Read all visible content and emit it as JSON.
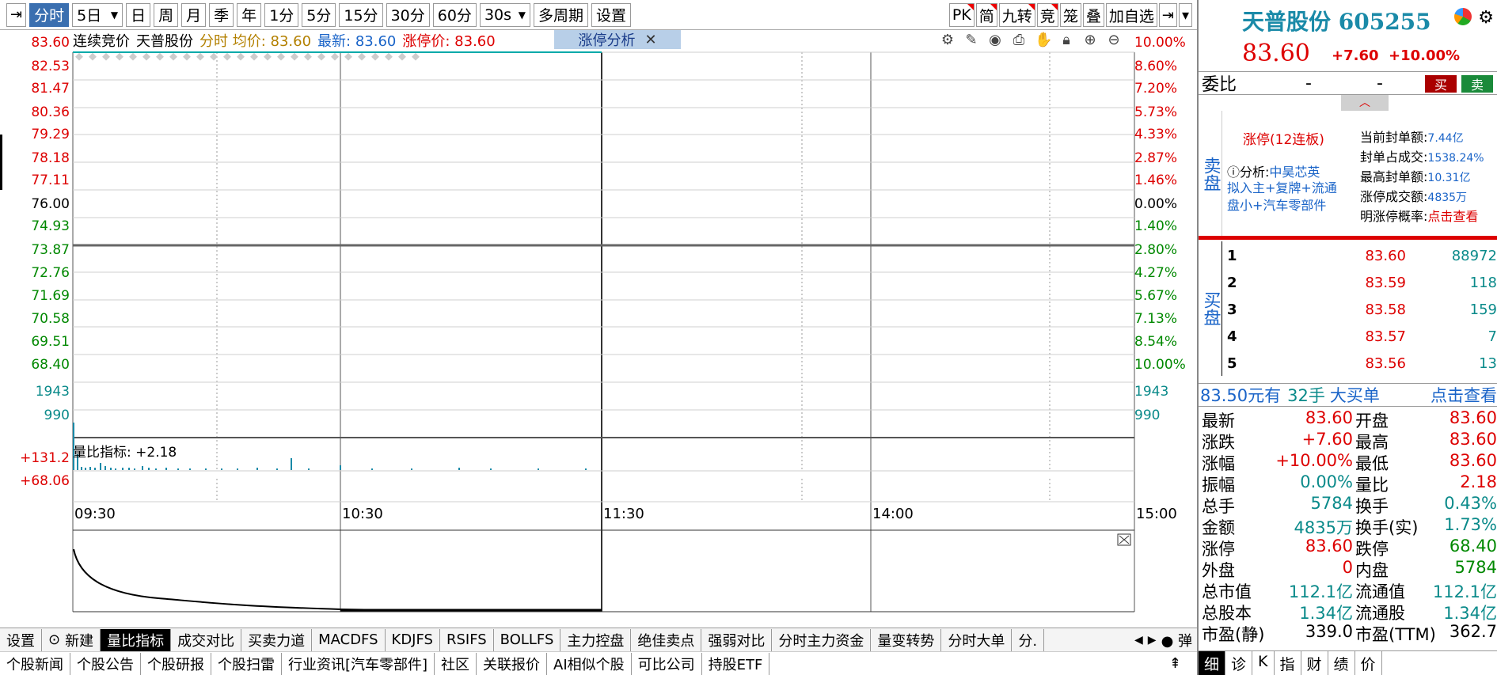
{
  "toolbar": {
    "items": [
      "分时",
      "5日",
      "日",
      "周",
      "月",
      "季",
      "年",
      "1分",
      "5分",
      "15分",
      "30分",
      "60分",
      "30s",
      "多周期",
      "设置"
    ],
    "right_items": [
      "PK",
      "简",
      "九转",
      "竞",
      "笼",
      "叠",
      "加自选"
    ]
  },
  "chart": {
    "info": {
      "auction": "连续竞价",
      "name": "天普股份",
      "avg": "分时 均价: 83.60",
      "latest": "最新: 83.60",
      "limit": "涨停价: 83.60"
    },
    "analysis_box": "涨停分析",
    "y_left": [
      "83.60",
      "82.53",
      "81.47",
      "80.36",
      "79.29",
      "78.18",
      "77.11",
      "76.00",
      "74.93",
      "73.87",
      "72.76",
      "71.69",
      "70.58",
      "69.51",
      "68.40"
    ],
    "y_right": [
      "10.00%",
      "8.60%",
      "7.20%",
      "5.73%",
      "4.33%",
      "2.87%",
      "1.46%",
      "0.00%",
      "1.40%",
      "2.80%",
      "4.27%",
      "5.67%",
      "7.13%",
      "8.54%",
      "10.00%"
    ],
    "vol_left": [
      "1943",
      "990"
    ],
    "vol_right": [
      "1943",
      "990"
    ],
    "ind_left": [
      "+131.2",
      "+68.06"
    ],
    "indicator_label": "量比指标: +2.18",
    "x_labels": [
      "09:30",
      "10:30",
      "11:30",
      "14:00",
      "15:00"
    ]
  },
  "tabs_row1": [
    "设置",
    "新建",
    "量比指标",
    "成交对比",
    "买卖力道",
    "MACDFS",
    "KDJFS",
    "RSIFS",
    "BOLLFS",
    "主力控盘",
    "绝佳卖点",
    "强弱对比",
    "分时主力资金",
    "量变转势",
    "分时大单",
    "分."
  ],
  "tabs_row2": [
    "个股新闻",
    "个股公告",
    "个股研报",
    "个股扫雷",
    "行业资讯[汽车零部件]",
    "社区",
    "关联报价",
    "AI相似个股",
    "可比公司",
    "持股ETF"
  ],
  "toggle_label": "弹",
  "quote": {
    "title": "天普股份 605255",
    "price": "83.60",
    "change": "+7.60",
    "pct": "+10.00%",
    "weibi_label": "委比",
    "weibi_v1": "-",
    "weibi_v2": "-",
    "buy": "买",
    "sell": "卖",
    "sell_label": "卖盘",
    "buy_label": "买盘",
    "zt_title": "涨停(12连板)",
    "analysis_prefix": "分析:",
    "analysis_name": "中昊芯英",
    "analysis_text": "拟入主+复牌+流通盘小+汽车零部件",
    "zt_stats": [
      {
        "k": "当前封单额:",
        "v": "7.44亿"
      },
      {
        "k": "封单占成交:",
        "v": "1538.24%"
      },
      {
        "k": "最高封单额:",
        "v": "10.31亿"
      },
      {
        "k": "涨停成交额:",
        "v": "4835万"
      },
      {
        "k": "明涨停概率:",
        "v": "点击查看"
      }
    ],
    "bids": [
      {
        "n": "1",
        "p": "83.60",
        "q": "88972"
      },
      {
        "n": "2",
        "p": "83.59",
        "q": "118"
      },
      {
        "n": "3",
        "p": "83.58",
        "q": "159"
      },
      {
        "n": "4",
        "p": "83.57",
        "q": "7"
      },
      {
        "n": "5",
        "p": "83.56",
        "q": "13"
      }
    ],
    "big_order": {
      "price": "83.50元有",
      "hands": "32手",
      "label": "大买单",
      "link": "点击查看"
    },
    "stats": [
      {
        "k1": "最新",
        "v1": "83.60",
        "c1": "red",
        "k2": "开盘",
        "v2": "83.60",
        "c2": "red"
      },
      {
        "k1": "涨跌",
        "v1": "+7.60",
        "c1": "red",
        "k2": "最高",
        "v2": "83.60",
        "c2": "red"
      },
      {
        "k1": "涨幅",
        "v1": "+10.00%",
        "c1": "red",
        "k2": "最低",
        "v2": "83.60",
        "c2": "red"
      },
      {
        "k1": "振幅",
        "v1": "0.00%",
        "c1": "teal",
        "k2": "量比",
        "v2": "2.18",
        "c2": "red"
      },
      {
        "k1": "总手",
        "v1": "5784",
        "c1": "teal",
        "k2": "换手",
        "v2": "0.43%",
        "c2": "teal"
      },
      {
        "k1": "金额",
        "v1": "4835万",
        "c1": "teal",
        "k2": "换手(实)",
        "v2": "1.73%",
        "c2": "teal"
      },
      {
        "k1": "涨停",
        "v1": "83.60",
        "c1": "red",
        "k2": "跌停",
        "v2": "68.40",
        "c2": "green"
      },
      {
        "k1": "外盘",
        "v1": "0",
        "c1": "red",
        "k2": "内盘",
        "v2": "5784",
        "c2": "green"
      },
      {
        "k1": "总市值",
        "v1": "112.1亿",
        "c1": "teal",
        "k2": "流通值",
        "v2": "112.1亿",
        "c2": "teal"
      },
      {
        "k1": "总股本",
        "v1": "1.34亿",
        "c1": "teal",
        "k2": "流通股",
        "v2": "1.34亿",
        "c2": "teal"
      },
      {
        "k1": "市盈(静)",
        "v1": "339.0",
        "c1": "black",
        "k2": "市盈(TTM)",
        "v2": "362.7",
        "c2": "black"
      }
    ],
    "bottom_tabs": [
      "细",
      "诊",
      "K",
      "指",
      "财",
      "绩",
      "价"
    ]
  },
  "colors": {
    "up": "#d00000",
    "down": "#008000",
    "accent": "#3a6fb0",
    "teal": "#0a8a8a"
  }
}
